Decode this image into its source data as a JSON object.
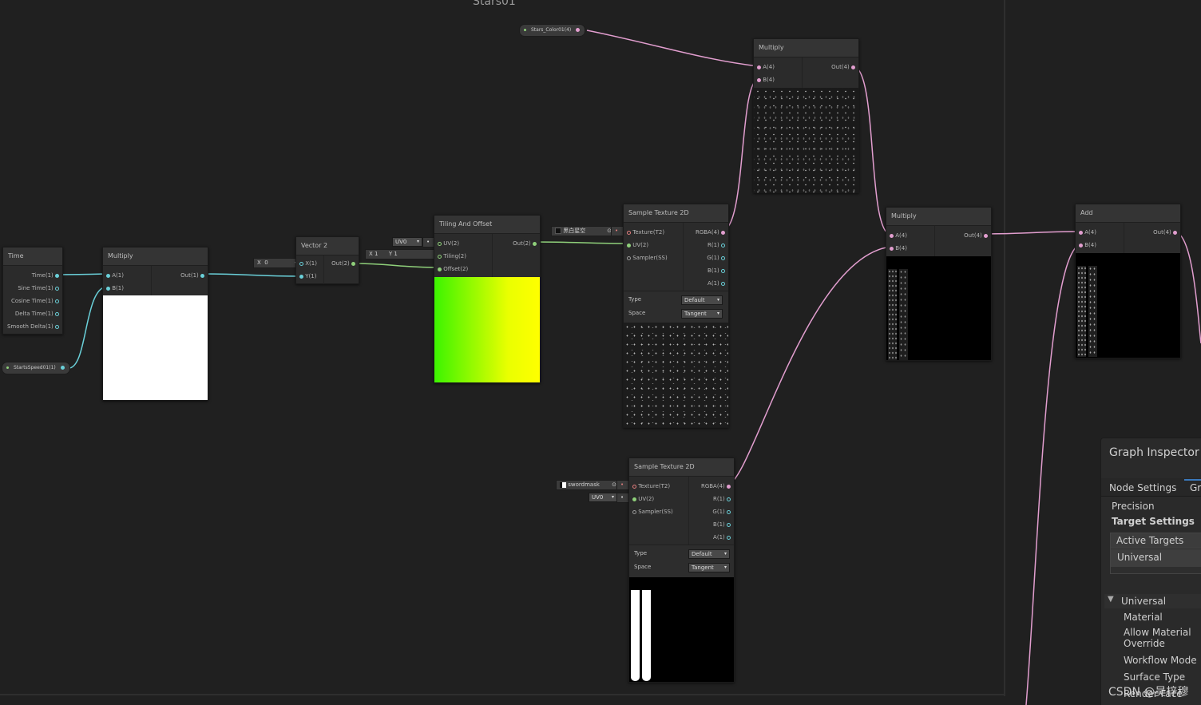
{
  "group": {
    "title": "Stars01"
  },
  "nodes": {
    "time": {
      "title": "Time",
      "outputs": [
        "Time(1)",
        "Sine Time(1)",
        "Cosine Time(1)",
        "Delta Time(1)",
        "Smooth Delta(1)"
      ]
    },
    "multiply1": {
      "title": "Multiply",
      "inputs": [
        "A(1)",
        "B(1)"
      ],
      "output": "Out(1)"
    },
    "vector2": {
      "title": "Vector 2",
      "inputs": [
        "X(1)",
        "Y(1)"
      ],
      "output": "Out(2)",
      "x_field_label": "X",
      "x_value": "0"
    },
    "tiling": {
      "title": "Tiling And Offset",
      "inputs": [
        "UV(2)",
        "Tiling(2)",
        "Offset(2)"
      ],
      "output": "Out(2)",
      "uv_dropdown": "UV0",
      "tiling_x_label": "X",
      "tiling_x": "1",
      "tiling_y_label": "Y",
      "tiling_y": "1"
    },
    "sample1": {
      "title": "Sample Texture 2D",
      "inputs": [
        "Texture(T2)",
        "UV(2)",
        "Sampler(SS)"
      ],
      "outputs": [
        "RGBA(4)",
        "R(1)",
        "G(1)",
        "B(1)",
        "A(1)"
      ],
      "texture_name": "黑白星空",
      "type_label": "Type",
      "type_value": "Default",
      "space_label": "Space",
      "space_value": "Tangent"
    },
    "sample2": {
      "title": "Sample Texture 2D",
      "inputs": [
        "Texture(T2)",
        "UV(2)",
        "Sampler(SS)"
      ],
      "outputs": [
        "RGBA(4)",
        "R(1)",
        "G(1)",
        "B(1)",
        "A(1)"
      ],
      "texture_name": "swordmask",
      "uv_dropdown": "UV0",
      "type_label": "Type",
      "type_value": "Default",
      "space_label": "Space",
      "space_value": "Tangent"
    },
    "multiply2": {
      "title": "Multiply",
      "inputs": [
        "A(4)",
        "B(4)"
      ],
      "output": "Out(4)"
    },
    "multiply3": {
      "title": "Multiply",
      "inputs": [
        "A(4)",
        "B(4)"
      ],
      "output": "Out(4)"
    },
    "add": {
      "title": "Add",
      "inputs": [
        "A(4)",
        "B(4)"
      ],
      "output": "Out(4)"
    }
  },
  "properties": {
    "stars_color": "Stars_Color01(4)",
    "stars_speed": "StartsSpeed01(1)"
  },
  "inspector": {
    "title": "Graph Inspector",
    "tabs": [
      "Node Settings",
      "Gra"
    ],
    "precision": "Precision",
    "target_settings": "Target Settings",
    "active_targets": "Active Targets",
    "universal_target": "Universal",
    "universal_section": "Universal",
    "items": [
      "Material",
      "Allow Material\nOverride",
      "Workflow Mode",
      "Surface Type",
      "Render Face"
    ]
  },
  "watermark": "CSDN @吴梓穆",
  "colors": {
    "wire_float": "#6ad0d9",
    "wire_vec2": "#8fd07a",
    "wire_vec4": "#e29ecf",
    "wire_tex": "#e07d7d",
    "accent": "#3a79bb"
  }
}
